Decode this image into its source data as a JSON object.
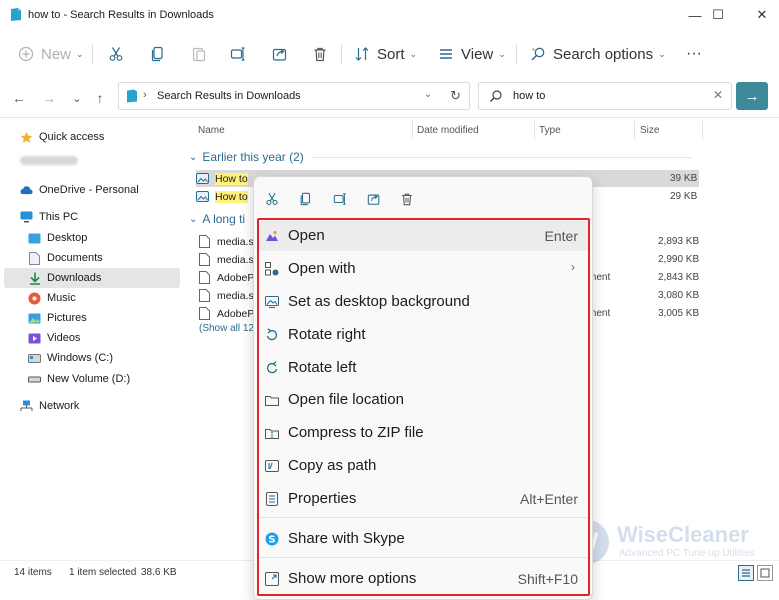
{
  "window": {
    "title": "how to - Search Results in Downloads",
    "minimize": "—",
    "maximize": "☐",
    "close": "✕"
  },
  "toolbar": {
    "new_label": "New",
    "sort_label": "Sort",
    "view_label": "View",
    "search_options_label": "Search options",
    "more_label": "···"
  },
  "address": {
    "path": "Search Results in Downloads",
    "search_value": "how to"
  },
  "sidebar": {
    "items": [
      {
        "label": "Quick access",
        "icon": "star-icon"
      },
      {
        "label": "",
        "icon": "cloud-icon",
        "blurred": true
      },
      {
        "label": "OneDrive - Personal",
        "icon": "cloud-icon"
      },
      {
        "label": "This PC",
        "icon": "computer-icon"
      },
      {
        "label": "Desktop",
        "icon": "desktop-icon"
      },
      {
        "label": "Documents",
        "icon": "document-icon"
      },
      {
        "label": "Downloads",
        "icon": "download-icon"
      },
      {
        "label": "Music",
        "icon": "music-icon"
      },
      {
        "label": "Pictures",
        "icon": "pictures-icon"
      },
      {
        "label": "Videos",
        "icon": "video-icon"
      },
      {
        "label": "Windows (C:)",
        "icon": "drive-icon"
      },
      {
        "label": "New Volume (D:)",
        "icon": "drive-icon"
      },
      {
        "label": "Network",
        "icon": "network-icon"
      }
    ]
  },
  "columns": {
    "name": "Name",
    "date_modified": "Date modified",
    "type": "Type",
    "size": "Size"
  },
  "groups": {
    "earlier": "Earlier this year (2)",
    "longtime": "A long ti"
  },
  "files_earlier": [
    {
      "name_hl": "How to",
      "name_rest": " ",
      "size": "39 KB"
    },
    {
      "name_hl": "How to",
      "name_rest": "",
      "size": "29 KB"
    }
  ],
  "files_longtime": [
    {
      "name": "media.s",
      "type": "",
      "size": "2,893 KB"
    },
    {
      "name": "media.s",
      "type": "",
      "size": "2,990 KB"
    },
    {
      "name": "AdobeP",
      "type": "ment",
      "size": "2,843 KB"
    },
    {
      "name": "media.s",
      "type": "",
      "size": "3,080 KB"
    },
    {
      "name": "AdobeP",
      "type": "ment",
      "size": "3,005 KB"
    }
  ],
  "show_all": "(Show all 12",
  "status": {
    "items": "14 items",
    "selected": "1 item selected",
    "size": "38.6 KB"
  },
  "context_menu": {
    "items": [
      {
        "label": "Open",
        "shortcut": "Enter",
        "icon": "photos-icon"
      },
      {
        "label": "Open with",
        "shortcut": "",
        "icon": "open-with-icon",
        "submenu": true
      },
      {
        "label": "Set as desktop background",
        "shortcut": "",
        "icon": "wallpaper-icon"
      },
      {
        "label": "Rotate right",
        "shortcut": "",
        "icon": "rotate-right-icon"
      },
      {
        "label": "Rotate left",
        "shortcut": "",
        "icon": "rotate-left-icon"
      },
      {
        "label": "Open file location",
        "shortcut": "",
        "icon": "folder-icon"
      },
      {
        "label": "Compress to ZIP file",
        "shortcut": "",
        "icon": "zip-icon"
      },
      {
        "label": "Copy as path",
        "shortcut": "",
        "icon": "copy-path-icon"
      },
      {
        "label": "Properties",
        "shortcut": "Alt+Enter",
        "icon": "properties-icon"
      },
      {
        "label": "Share with Skype",
        "shortcut": "",
        "icon": "skype-icon"
      },
      {
        "label": "Show more options",
        "shortcut": "Shift+F10",
        "icon": "more-options-icon"
      }
    ]
  },
  "watermark": {
    "logo_letter": "W",
    "name": "WiseCleaner",
    "tagline": "Advanced PC Tune-up Utilities"
  },
  "colors": {
    "accent": "#2b6c8d",
    "highlight_frame": "#e0242e",
    "go_button": "#3d8a9c",
    "search_highlight": "#fff27a"
  }
}
